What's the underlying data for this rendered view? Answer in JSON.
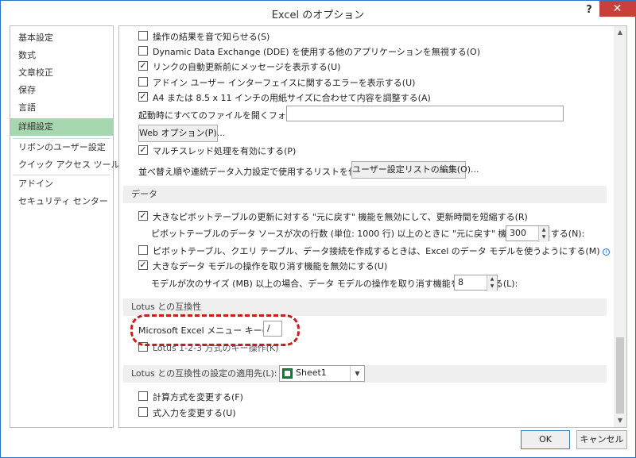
{
  "window": {
    "title": "Excel のオプション",
    "help_label": "?",
    "close_label": "✕"
  },
  "nav": {
    "items": [
      {
        "label": "基本設定"
      },
      {
        "label": "数式"
      },
      {
        "label": "文章校正"
      },
      {
        "label": "保存"
      },
      {
        "label": "言語"
      },
      {
        "label": "詳細設定",
        "selected": true
      },
      {
        "label": "リボンのユーザー設定"
      },
      {
        "label": "クイック アクセス ツール バー"
      },
      {
        "label": "アドイン"
      },
      {
        "label": "セキュリティ センター"
      }
    ]
  },
  "general": {
    "opt_sound": {
      "label": "操作の結果を音で知らせる(S)",
      "checked": false
    },
    "opt_dde": {
      "label": "Dynamic Data Exchange (DDE) を使用する他のアプリケーションを無視する(O)",
      "checked": false
    },
    "opt_links": {
      "label": "リンクの自動更新前にメッセージを表示する(U)",
      "checked": true
    },
    "opt_addin_errors": {
      "label": "アドイン ユーザー インターフェイスに関するエラーを表示する(U)",
      "checked": false
    },
    "opt_a4": {
      "label": "A4 または 8.5 x 11 インチの用紙サイズに合わせて内容を調整する(A)",
      "checked": true
    },
    "startup_folder_label": "起動時にすべてのファイルを開くフォルダー(L):",
    "startup_folder_value": "",
    "web_options_button": "Web オプション(P)...",
    "opt_multithread": {
      "label": "マルチスレッド処理を有効にする(P)",
      "checked": true
    },
    "custom_lists_label": "並べ替え順や連続データ入力設定で使用するリストを作成します:",
    "custom_lists_button": "ユーザー設定リストの編集(O)..."
  },
  "data_section": {
    "heading": "データ",
    "opt_pivot_undo": {
      "label": "大きなピボットテーブルの更新に対する \"元に戻す\" 機能を無効にして、更新時間を短縮する(R)",
      "checked": true
    },
    "pivot_rows_label": "ピボットテーブルのデータ ソースが次の行数 (単位: 1000 行) 以上のときに \"元に戻す\" 機能を無効にする(N):",
    "pivot_rows_value": "300",
    "opt_data_model": {
      "label": "ピボットテーブル、クエリ テーブル、データ接続を作成するときは、Excel のデータ モデルを使うようにする(M)",
      "checked": false
    },
    "opt_model_undo": {
      "label": "大きなデータ モデルの操作を取り消す機能を無効にする(U)",
      "checked": true
    },
    "model_size_label": "モデルが次のサイズ (MB) 以上の場合、データ モデルの操作を取り消す機能を無効にする(L):",
    "model_size_value": "8"
  },
  "lotus_section": {
    "heading": "Lotus との互換性",
    "menu_key_label": "Microsoft Excel メニュー キー(M):",
    "menu_key_value": "/",
    "opt_lotus_keys": {
      "label": "Lotus 1-2-3 方式のキー操作(K)",
      "checked": false
    }
  },
  "lotus_settings_section": {
    "heading": "Lotus との互換性の設定の適用先(L):",
    "sheet_value": "Sheet1",
    "opt_formula_eval": {
      "label": "計算方式を変更する(F)",
      "checked": false
    },
    "opt_formula_entry": {
      "label": "式入力を変更する(U)",
      "checked": false
    }
  },
  "footer": {
    "ok_label": "OK",
    "cancel_label": "キャンセル"
  },
  "icons": {
    "check_glyph": "✓",
    "scroll_up": "▲",
    "scroll_down": "▼",
    "spin_up": "▲",
    "spin_down": "▼",
    "combo_arrow": "▼",
    "info": "i"
  },
  "colors": {
    "nav_selected": "#a7d7ae",
    "close_button": "#c7403a",
    "callout_border": "#c41f1f",
    "window_border": "#2c74c6"
  }
}
